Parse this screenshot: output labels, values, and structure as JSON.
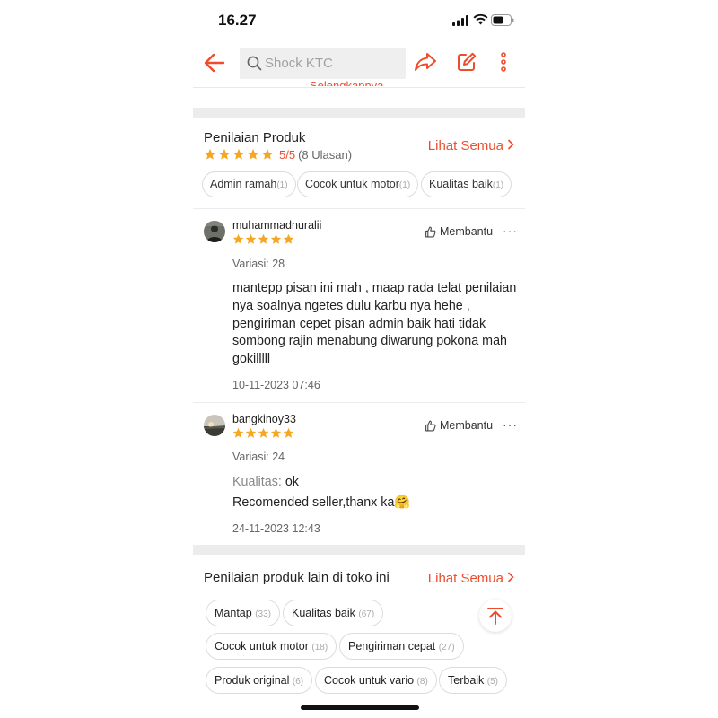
{
  "status_bar": {
    "time": "16.27"
  },
  "header": {
    "search_placeholder": "Shock KTC"
  },
  "prev_section_link": "Selengkapnya",
  "rating": {
    "title": "Penilaian Produk",
    "see_all": "Lihat Semua",
    "score": "5/5",
    "count": "(8 Ulasan)",
    "star_color": "#f5a623",
    "chips": [
      {
        "label": "Admin ramah",
        "count": "(1)"
      },
      {
        "label": "Cocok untuk motor",
        "count": "(1)"
      },
      {
        "label": "Kualitas baik",
        "count": "(1)"
      }
    ]
  },
  "reviews": [
    {
      "username": "muhammadnuralii",
      "stars": 5,
      "helpful_label": "Membantu",
      "variant": "Variasi: 28",
      "text": "mantepp pisan ini mah , maap rada telat penilaian nya soalnya ngetes dulu karbu nya hehe , pengiriman cepet pisan admin baik hati tidak sombong rajin menabung diwarung pokona mah gokilllll",
      "date": "10-11-2023 07:46"
    },
    {
      "username": "bangkinoy33",
      "stars": 5,
      "helpful_label": "Membantu",
      "variant": "Variasi: 24",
      "quality_label": "Kualitas:",
      "quality_value": "ok",
      "text": "Recomended seller,thanx ka🤗",
      "date": "24-11-2023 12:43"
    }
  ],
  "shop_ratings": {
    "title": "Penilaian produk lain di toko ini",
    "see_all": "Lihat Semua",
    "chips": [
      {
        "label": "Mantap",
        "count": "(33)"
      },
      {
        "label": "Kualitas baik",
        "count": "(67)"
      },
      {
        "label": "Cocok untuk motor",
        "count": "(18)"
      },
      {
        "label": "Pengiriman cepat",
        "count": "(27)"
      },
      {
        "label": "Produk original",
        "count": "(6)"
      },
      {
        "label": "Cocok untuk vario",
        "count": "(8)"
      },
      {
        "label": "Terbaik",
        "count": "(5)"
      }
    ]
  },
  "colors": {
    "accent": "#ee4d2d",
    "star": "#f5a623"
  }
}
